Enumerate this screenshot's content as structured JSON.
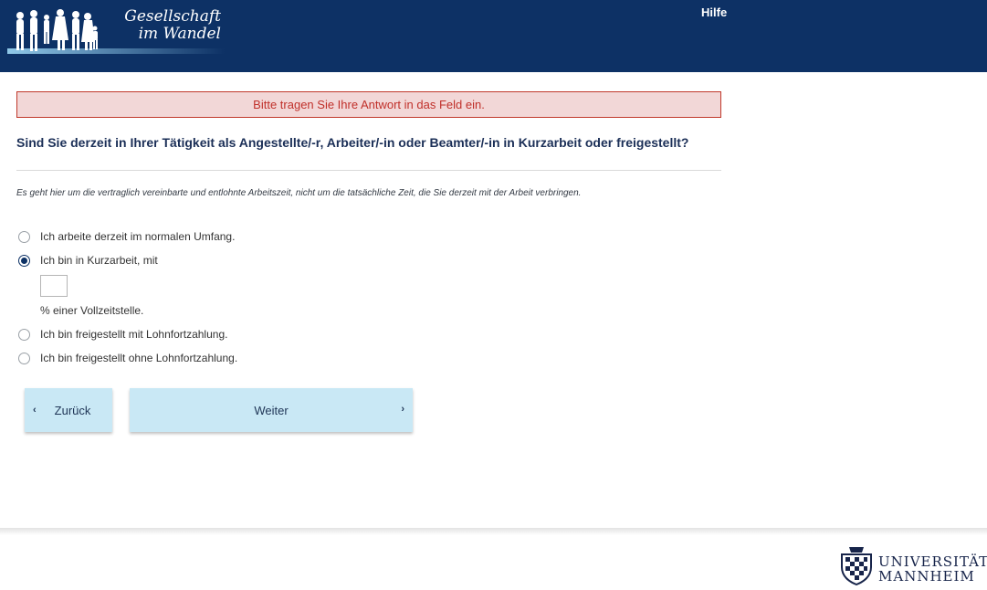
{
  "header": {
    "logo_line1": "Gesellschaft",
    "logo_line2": "im Wandel",
    "help_label": "Hilfe"
  },
  "error": {
    "message": "Bitte tragen Sie Ihre Antwort in das Feld ein."
  },
  "question": {
    "text": "Sind Sie derzeit in Ihrer Tätigkeit als Angestellte/-r, Arbeiter/-in oder Beamter/-in in Kurzarbeit oder freigestellt?",
    "hint": "Es geht hier um die vertraglich vereinbarte und entlohnte Arbeitszeit, nicht um die tatsächliche Zeit, die Sie derzeit mit der Arbeit verbringen."
  },
  "options": [
    {
      "label": "Ich arbeite derzeit im normalen Umfang.",
      "selected": false
    },
    {
      "label": "Ich bin in Kurzarbeit, mit",
      "selected": true
    },
    {
      "label": "Ich bin freigestellt mit Lohnfortzahlung.",
      "selected": false
    },
    {
      "label": "Ich bin freigestellt ohne Lohnfortzahlung.",
      "selected": false
    }
  ],
  "percent_field": {
    "value": "",
    "suffix": "% einer Vollzeitstelle."
  },
  "nav": {
    "back_label": "Zurück",
    "next_label": "Weiter"
  },
  "footer": {
    "uni_line1": "UNIVERSITÄT",
    "uni_line2": "MANNHEIM"
  },
  "colors": {
    "header_bg": "#0d3165",
    "button_bg": "#c9e8f5",
    "error_border": "#c0392b",
    "error_bg": "#f2d7d7"
  }
}
